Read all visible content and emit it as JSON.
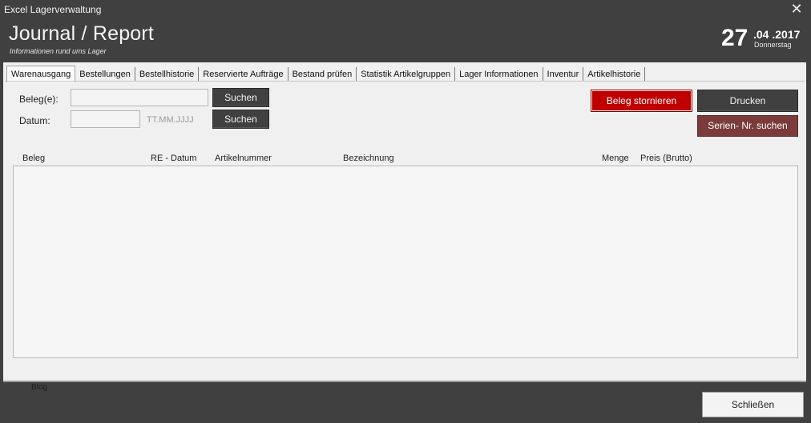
{
  "window": {
    "title": "Excel Lagerverwaltung",
    "close_glyph": "✕"
  },
  "header": {
    "title": "Journal / Report",
    "subtitle": "Informationen rund ums Lager",
    "date_day": "27",
    "date_monthyear": ".04 .2017",
    "date_weekday": "Donnerstag"
  },
  "tabs": [
    {
      "label": "Warenausgang",
      "active": true
    },
    {
      "label": "Bestellungen"
    },
    {
      "label": "Bestellhistorie"
    },
    {
      "label": "Reservierte Aufträge"
    },
    {
      "label": "Bestand prüfen"
    },
    {
      "label": "Statistik Artikelgruppen"
    },
    {
      "label": "Lager Informationen"
    },
    {
      "label": "Inventur"
    },
    {
      "label": "Artikelhistorie"
    }
  ],
  "form": {
    "beleg_label": "Beleg(e):",
    "beleg_value": "",
    "datum_label": "Datum:",
    "datum_value": "",
    "datum_hint": "TT.MM.JJJJ",
    "search_label_1": "Suchen",
    "search_label_2": "Suchen"
  },
  "actions": {
    "storno": "Beleg stornieren",
    "drucken": "Drucken",
    "serien": "Serien- Nr. suchen"
  },
  "table": {
    "columns": [
      "Beleg",
      "RE - Datum",
      "Artikelnummer",
      "Bezeichnung",
      "Menge",
      "Preis (Brutto)"
    ],
    "rows": []
  },
  "footer": {
    "blog": "Blog",
    "close": "Schließen"
  }
}
